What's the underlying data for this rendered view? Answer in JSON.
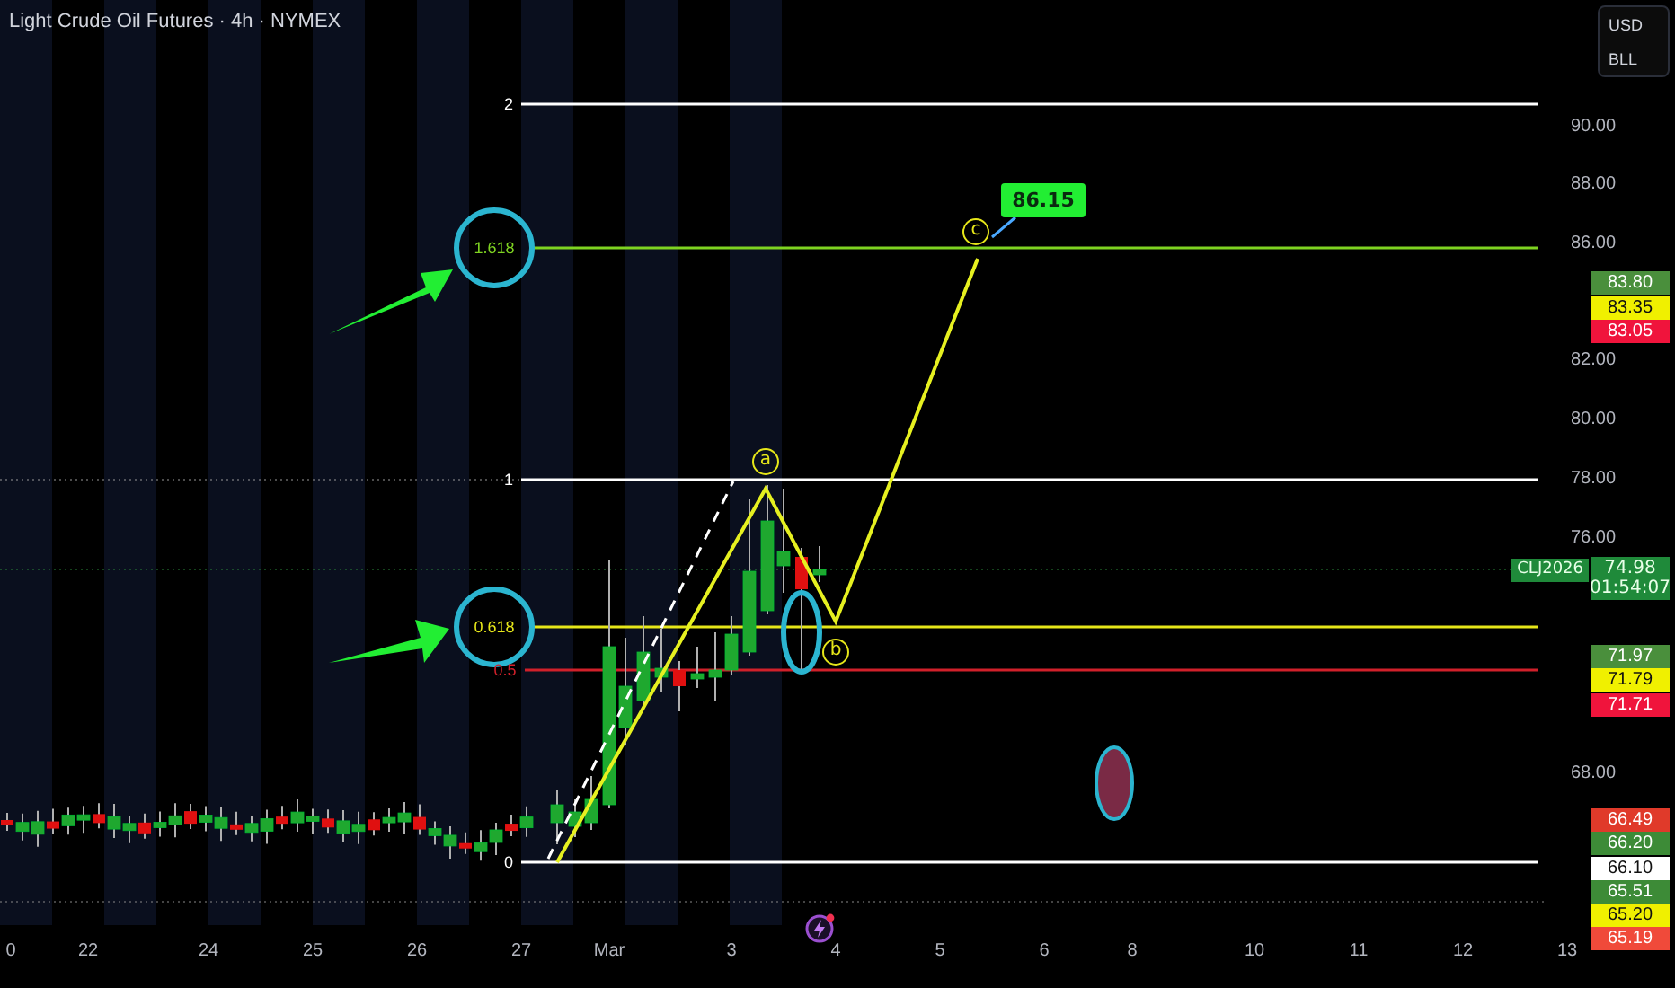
{
  "header": {
    "title": "Light Crude Oil Futures · 4h · NYMEX"
  },
  "currency_box": {
    "currency": "USD",
    "unit": "BLL"
  },
  "fib_levels": [
    {
      "label": "2",
      "color": "#ffffff"
    },
    {
      "label": "1.618",
      "color": "#7ed321"
    },
    {
      "label": "1",
      "color": "#ffffff"
    },
    {
      "label": "0.618",
      "color": "#e6e619"
    },
    {
      "label": "0.5",
      "color": "#d0202a"
    },
    {
      "label": "0",
      "color": "#ffffff"
    }
  ],
  "wave_labels": [
    "a",
    "b",
    "c"
  ],
  "target_tag": "86.15",
  "price_axis": {
    "ticks": [
      "90.00",
      "88.00",
      "86.00",
      "82.00",
      "80.00",
      "78.00",
      "76.00",
      "68.00"
    ]
  },
  "price_tags": [
    {
      "value": "83.80",
      "color": "#4a8f3c"
    },
    {
      "value": "83.35",
      "color": "#f0f000"
    },
    {
      "value": "83.05",
      "color": "#f0143c"
    },
    {
      "value": "71.97",
      "color": "#4a8f3c"
    },
    {
      "value": "71.79",
      "color": "#f0f000"
    },
    {
      "value": "71.71",
      "color": "#f0143c"
    },
    {
      "value": "66.49",
      "color": "#e03a2a"
    },
    {
      "value": "66.20",
      "color": "#3d8b37"
    },
    {
      "value": "66.10",
      "color": "#ffffff"
    },
    {
      "value": "65.51",
      "color": "#3d8b37"
    },
    {
      "value": "65.20",
      "color": "#f0f000"
    },
    {
      "value": "65.19",
      "color": "#f04a3a"
    }
  ],
  "symbol_tag": {
    "symbol": "CLJ2026",
    "price": "74.98",
    "countdown": "01:54:07"
  },
  "time_axis": {
    "ticks": [
      "0",
      "22",
      "24",
      "25",
      "26",
      "27",
      "Mar",
      "3",
      "4",
      "5",
      "6",
      "8",
      "10",
      "11",
      "12",
      "13"
    ]
  }
}
